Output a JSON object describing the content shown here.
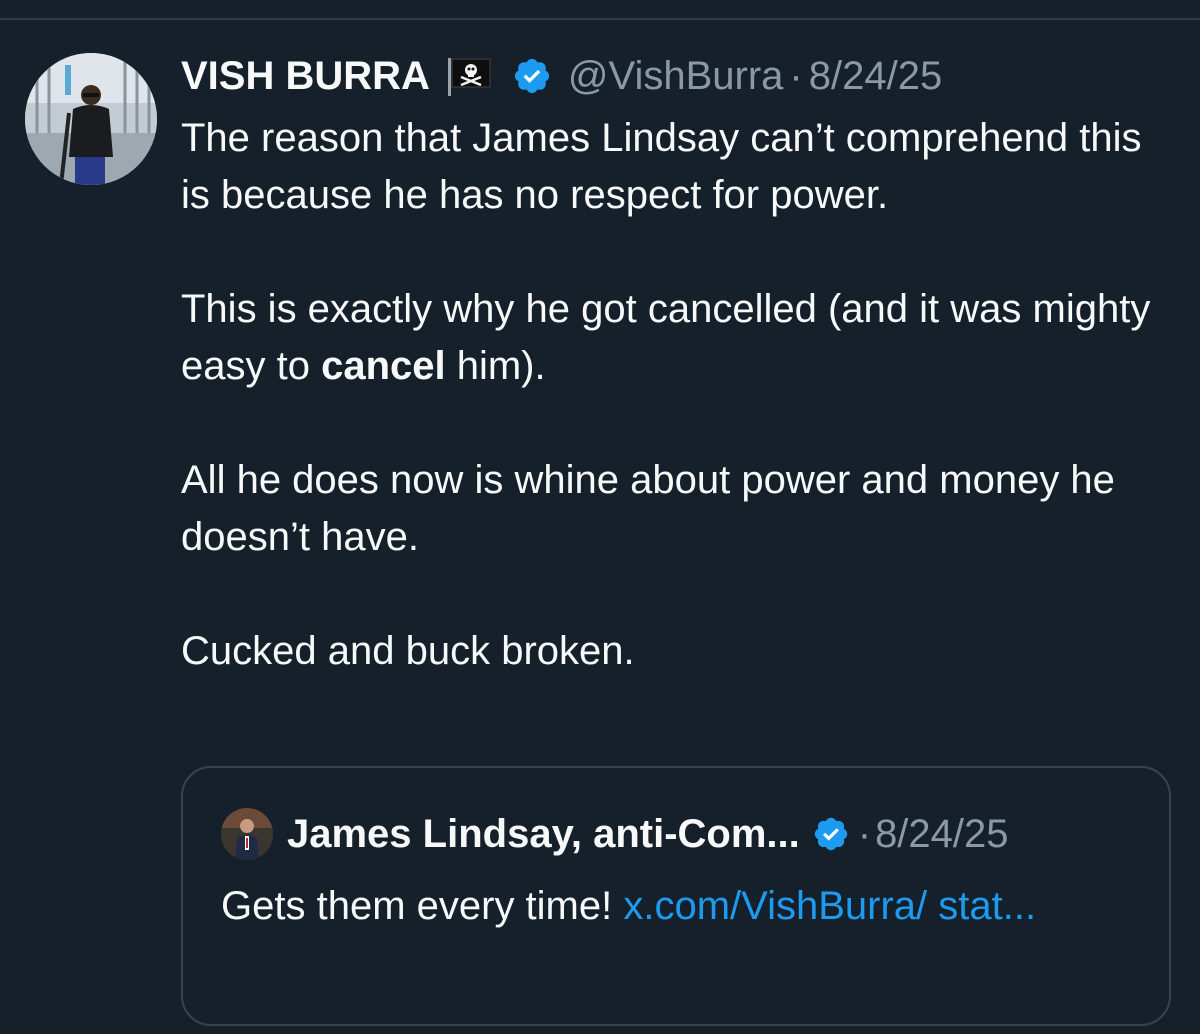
{
  "tweet": {
    "display_name": "VISH BURRA",
    "handle": "@VishBurra",
    "separator": "·",
    "date": "8/24/25",
    "paragraphs": {
      "p1": "The reason that James Lindsay can’t comprehend this is because he has no respect for power.",
      "p2_before": "This is exactly why he got cancelled (and it was mighty easy to ",
      "p2_bold": "cancel",
      "p2_after": " him).",
      "p3": "All he does now is whine about power and money he doesn’t have.",
      "p4": "Cucked and buck broken."
    },
    "icons": {
      "flag": "pirate-flag-icon",
      "verified": "verified-badge-icon"
    }
  },
  "quote": {
    "display_name": "James Lindsay, anti-Com...",
    "separator": "·",
    "date": "8/24/25",
    "text": "Gets them every time! ",
    "link_text": "x.com/VishBurra/ stat..."
  },
  "colors": {
    "background": "#15202b",
    "text_primary": "#f7f9f9",
    "text_secondary": "#8b98a5",
    "link": "#1d9bf0",
    "verified": "#1d9bf0",
    "border": "#38444d"
  }
}
